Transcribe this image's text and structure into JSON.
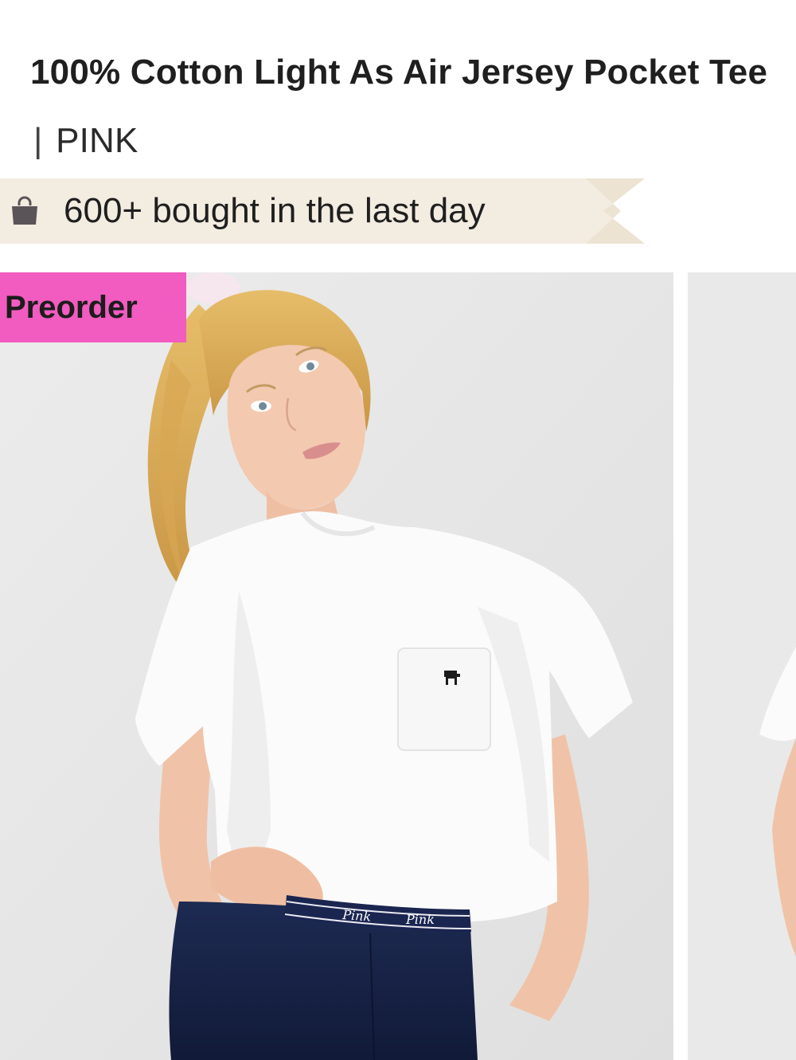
{
  "product": {
    "title": "100% Cotton Light As Air Jersey Pocket Tee",
    "separator": "|",
    "brand": "PINK"
  },
  "social_proof": {
    "icon": "shopping-bag-icon",
    "text": "600+ bought in the last day",
    "banner_color": "#f3ece1"
  },
  "gallery": {
    "badge": "Preorder",
    "badge_color": "#f25bbf",
    "waistband_text": "Pink"
  }
}
